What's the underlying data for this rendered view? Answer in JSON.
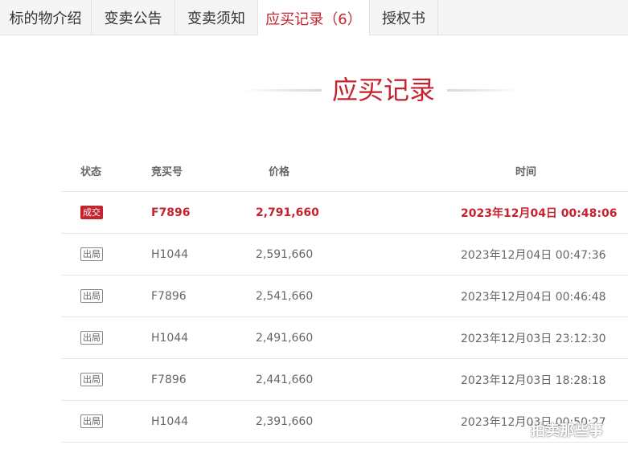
{
  "tabs": [
    {
      "label": "标的物介绍"
    },
    {
      "label": "变卖公告"
    },
    {
      "label": "变卖须知"
    },
    {
      "label": "应买记录（6）"
    },
    {
      "label": "授权书"
    }
  ],
  "section_title": "应买记录",
  "table": {
    "headers": [
      "状态",
      "竞买号",
      "价格",
      "时间"
    ],
    "rows": [
      {
        "status": "成交",
        "bidder": "F7896",
        "price": "2,791,660",
        "time": "2023年12月04日 00:48:06"
      },
      {
        "status": "出局",
        "bidder": "H1044",
        "price": "2,591,660",
        "time": "2023年12月04日 00:47:36"
      },
      {
        "status": "出局",
        "bidder": "F7896",
        "price": "2,541,660",
        "time": "2023年12月04日 00:46:48"
      },
      {
        "status": "出局",
        "bidder": "H1044",
        "price": "2,491,660",
        "time": "2023年12月03日 23:12:30"
      },
      {
        "status": "出局",
        "bidder": "F7896",
        "price": "2,441,660",
        "time": "2023年12月03日 18:28:18"
      },
      {
        "status": "出局",
        "bidder": "H1044",
        "price": "2,391,660",
        "time": "2023年12月03日 00:50:27"
      }
    ]
  },
  "watermark": "拍卖那些事",
  "colors": {
    "accent": "#c5232e",
    "tab_bg": "#f5f5f5",
    "border": "#e2e2e2"
  }
}
